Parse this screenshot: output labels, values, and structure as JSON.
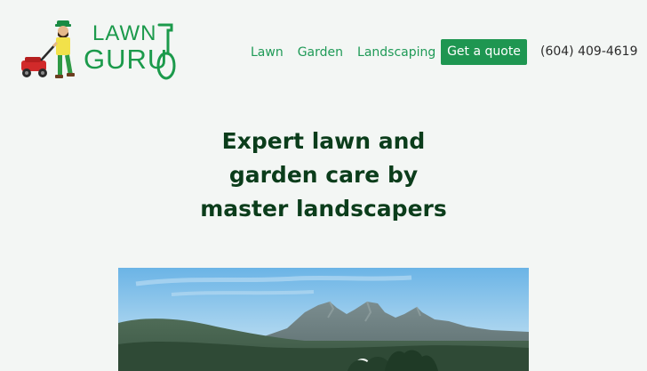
{
  "brand": {
    "logo_line1": "LAWN",
    "logo_line2": "GURU",
    "colors": {
      "brand_green": "#1b9a4b",
      "heading": "#0b3d1b",
      "background": "#f3f6f4",
      "button_bg": "#1e9651"
    }
  },
  "nav": {
    "items": [
      {
        "label": "Lawn"
      },
      {
        "label": "Garden"
      },
      {
        "label": "Landscaping"
      }
    ]
  },
  "cta": {
    "label": "Get a quote"
  },
  "contact": {
    "phone": "(604) 409-4619"
  },
  "hero": {
    "title_lines": [
      "Expert lawn and",
      "garden care by",
      "master landscapers"
    ]
  },
  "icons": {
    "mascot": "mower-man-icon",
    "shovel": "shovel-icon",
    "hero_photo": "mountain-landscape-photo"
  }
}
